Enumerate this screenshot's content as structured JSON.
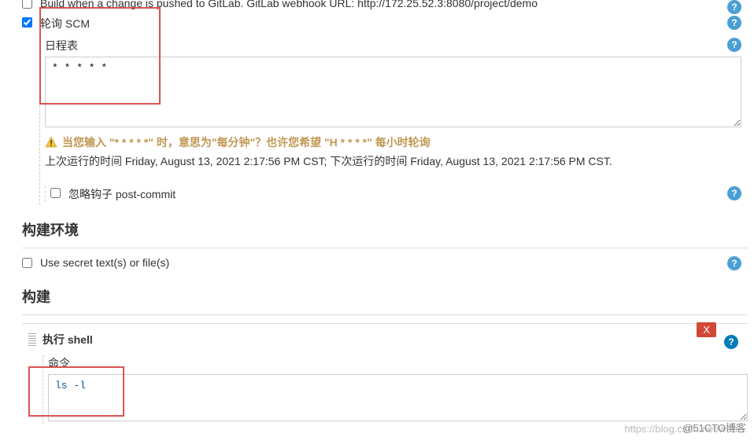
{
  "triggers": {
    "gitlab_push_row": {
      "label_prefix": "Build when a change is pushed to GitLab. GitLab webhook URL: ",
      "url": "http://172.25.52.3:8080/project/demo"
    },
    "poll_scm": {
      "label": "轮询 SCM",
      "schedule_label": "日程表",
      "schedule_value": "* * * * *",
      "warning": "当您输入 \"* * * * *\" 时，意思为\"每分钟\"？也许您希望 \"H * * * *\" 每小时轮询",
      "last_next": "上次运行的时间 Friday, August 13, 2021 2:17:56 PM CST; 下次运行的时间 Friday, August 13, 2021 2:17:56 PM CST.",
      "ignore_hooks": "忽略钩子 post-commit"
    }
  },
  "sections": {
    "build_env": "构建环境",
    "build": "构建"
  },
  "build_env": {
    "use_secret": "Use secret text(s) or file(s)"
  },
  "build_step": {
    "title": "执行 shell",
    "command_label": "命令",
    "command_value": "ls -l",
    "delete": "X"
  },
  "watermark1": "https://blog.csdn.net/web...",
  "watermark2": "@51CTO博客"
}
